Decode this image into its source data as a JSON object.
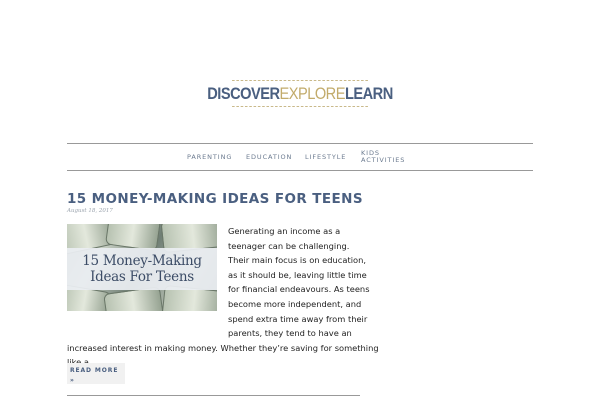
{
  "logo": {
    "part1": "DISCOVER",
    "part2": "EXPLORE",
    "part3": "LEARN"
  },
  "nav": {
    "items": [
      "PARENTING",
      "EDUCATION",
      "LIFESTYLE"
    ],
    "kids_line1": "KIDS",
    "kids_line2": "ACTIVITIES"
  },
  "post": {
    "title": "15 MONEY-MAKING IDEAS FOR TEENS",
    "date": "August 18, 2017",
    "thumb_line1": "15 Money-Making",
    "thumb_line2": "Ideas For Teens",
    "excerpt_lines": [
      "Generating an income as a",
      "teenager can be challenging.",
      "Their main focus is on education,",
      "as it should be, leaving little time",
      "for financial endeavours. As teens",
      "become more independent, and",
      "spend extra time away from their",
      "parents, they tend to have an",
      "increased interest in making money. Whether they’re saving for something",
      "like a…"
    ],
    "read_more": "READ MORE",
    "read_more_arrow": "»"
  },
  "colors": {
    "accent_blue": "#4a5f80",
    "accent_gold": "#c2ab6b",
    "date_gray": "#9aa3ad"
  }
}
